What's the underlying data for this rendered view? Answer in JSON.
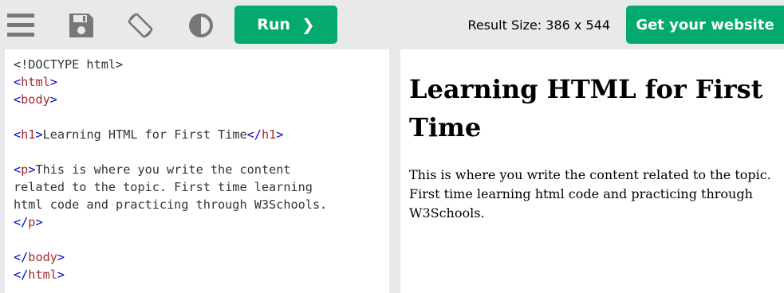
{
  "toolbar": {
    "icons": [
      "menu-icon",
      "save-icon",
      "rotate-icon",
      "contrast-icon"
    ],
    "run_label": "Run",
    "run_icon": "chevron-right-icon",
    "result_size": "Result Size: 386 x 544",
    "website_label": "Get your website",
    "accent_color": "#04aa6d"
  },
  "editor": {
    "lines": [
      [
        "<!DOCTYPE html>"
      ],
      [
        "<",
        "html",
        ">"
      ],
      [
        "<",
        "body",
        ">"
      ],
      [
        ""
      ],
      [
        "<",
        "h1",
        ">",
        "Learning HTML for First Time",
        "</",
        "h1",
        ">"
      ],
      [
        ""
      ],
      [
        "<",
        "p",
        ">",
        "This is where you write the content"
      ],
      [
        "related to the topic. First time learning"
      ],
      [
        "html code and practicing through W3Schools."
      ],
      [
        "</",
        "p",
        ">"
      ],
      [
        ""
      ],
      [
        "</",
        "body",
        ">"
      ],
      [
        "</",
        "html",
        ">"
      ]
    ]
  },
  "result": {
    "heading": "Learning HTML for First Time",
    "paragraph": "This is where you write the content related to the topic. First time learning html code and practicing through W3Schools."
  }
}
